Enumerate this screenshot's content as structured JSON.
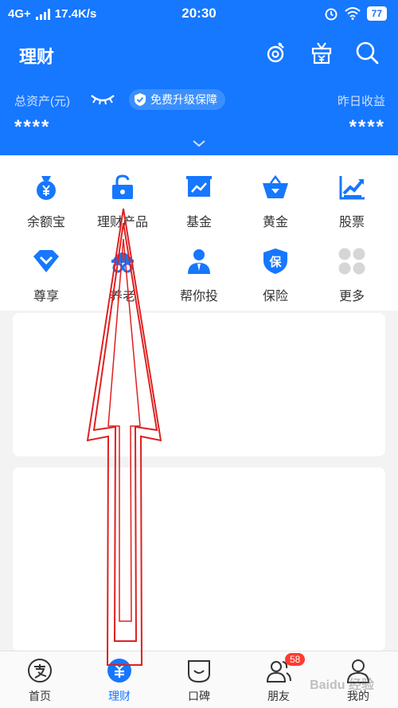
{
  "status_bar": {
    "network": "4G+",
    "speed": "17.4K/s",
    "time": "20:30",
    "battery": "77"
  },
  "header": {
    "title": "理财",
    "assets_label": "总资产(元)",
    "upgrade_label": "免费升级保障",
    "yesterday_label": "昨日收益",
    "assets_masked": "****",
    "yesterday_masked": "****"
  },
  "grid": {
    "row1": [
      {
        "label": "余额宝",
        "icon": "money-bag-icon"
      },
      {
        "label": "理财产品",
        "icon": "lock-icon"
      },
      {
        "label": "基金",
        "icon": "chart-board-icon"
      },
      {
        "label": "黄金",
        "icon": "gold-basket-icon"
      },
      {
        "label": "股票",
        "icon": "stock-trend-icon"
      }
    ],
    "row2": [
      {
        "label": "尊享",
        "icon": "diamond-icon"
      },
      {
        "label": "养老",
        "icon": "elder-icon"
      },
      {
        "label": "帮你投",
        "icon": "advisor-icon"
      },
      {
        "label": "保险",
        "icon": "insurance-shield-icon"
      },
      {
        "label": "更多",
        "icon": "more-icon"
      }
    ]
  },
  "insurance_glyph": "保",
  "tabbar": [
    {
      "label": "首页",
      "icon": "alipay-home-icon"
    },
    {
      "label": "理财",
      "icon": "finance-icon",
      "active": true
    },
    {
      "label": "口碑",
      "icon": "koubei-icon"
    },
    {
      "label": "朋友",
      "icon": "friends-icon",
      "badge": "58"
    },
    {
      "label": "我的",
      "icon": "profile-icon"
    }
  ],
  "watermark": "Baidu 经验",
  "colors": {
    "primary": "#1677ff",
    "annotation": "#e02020"
  }
}
